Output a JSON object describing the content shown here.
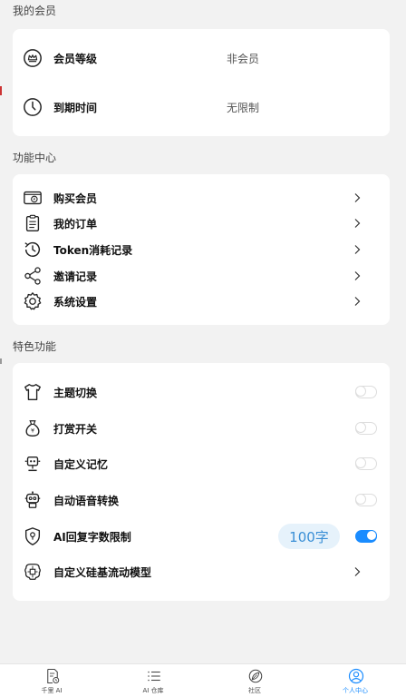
{
  "membership": {
    "section_title": "我的会员",
    "level_label": "会员等级",
    "level_value": "非会员",
    "expiry_label": "到期时间",
    "expiry_value": "无限制"
  },
  "features": {
    "section_title": "功能中心",
    "items": [
      {
        "label": "购买会员",
        "icon": "wallet-icon"
      },
      {
        "label": "我的订单",
        "icon": "clipboard-icon"
      },
      {
        "label": "Token消耗记录",
        "icon": "history-icon"
      },
      {
        "label": "邀请记录",
        "icon": "share-icon"
      },
      {
        "label": "系统设置",
        "icon": "gear-icon"
      }
    ]
  },
  "special": {
    "section_title": "特色功能",
    "items": [
      {
        "label": "主题切换",
        "icon": "shirt-icon",
        "enabled": false
      },
      {
        "label": "打赏开关",
        "icon": "money-bag-icon",
        "enabled": false
      },
      {
        "label": "自定义记忆",
        "icon": "robot-icon",
        "enabled": false
      },
      {
        "label": "自动语音转换",
        "icon": "robot-voice-icon",
        "enabled": false
      },
      {
        "label": "AI回复字数限制",
        "icon": "shield-lock-icon",
        "enabled": true,
        "badge": "100字"
      },
      {
        "label": "自定义硅基流动模型",
        "icon": "brain-chip-icon"
      }
    ]
  },
  "tabbar": {
    "active_color": "#1a8cff",
    "tabs": [
      {
        "label": "千里 AI",
        "icon": "document-clock-icon",
        "active": false
      },
      {
        "label": "AI 仓库",
        "icon": "list-icon",
        "active": false
      },
      {
        "label": "社区",
        "icon": "leaf-icon",
        "active": false
      },
      {
        "label": "个人中心",
        "icon": "user-circle-icon",
        "active": true
      }
    ]
  }
}
